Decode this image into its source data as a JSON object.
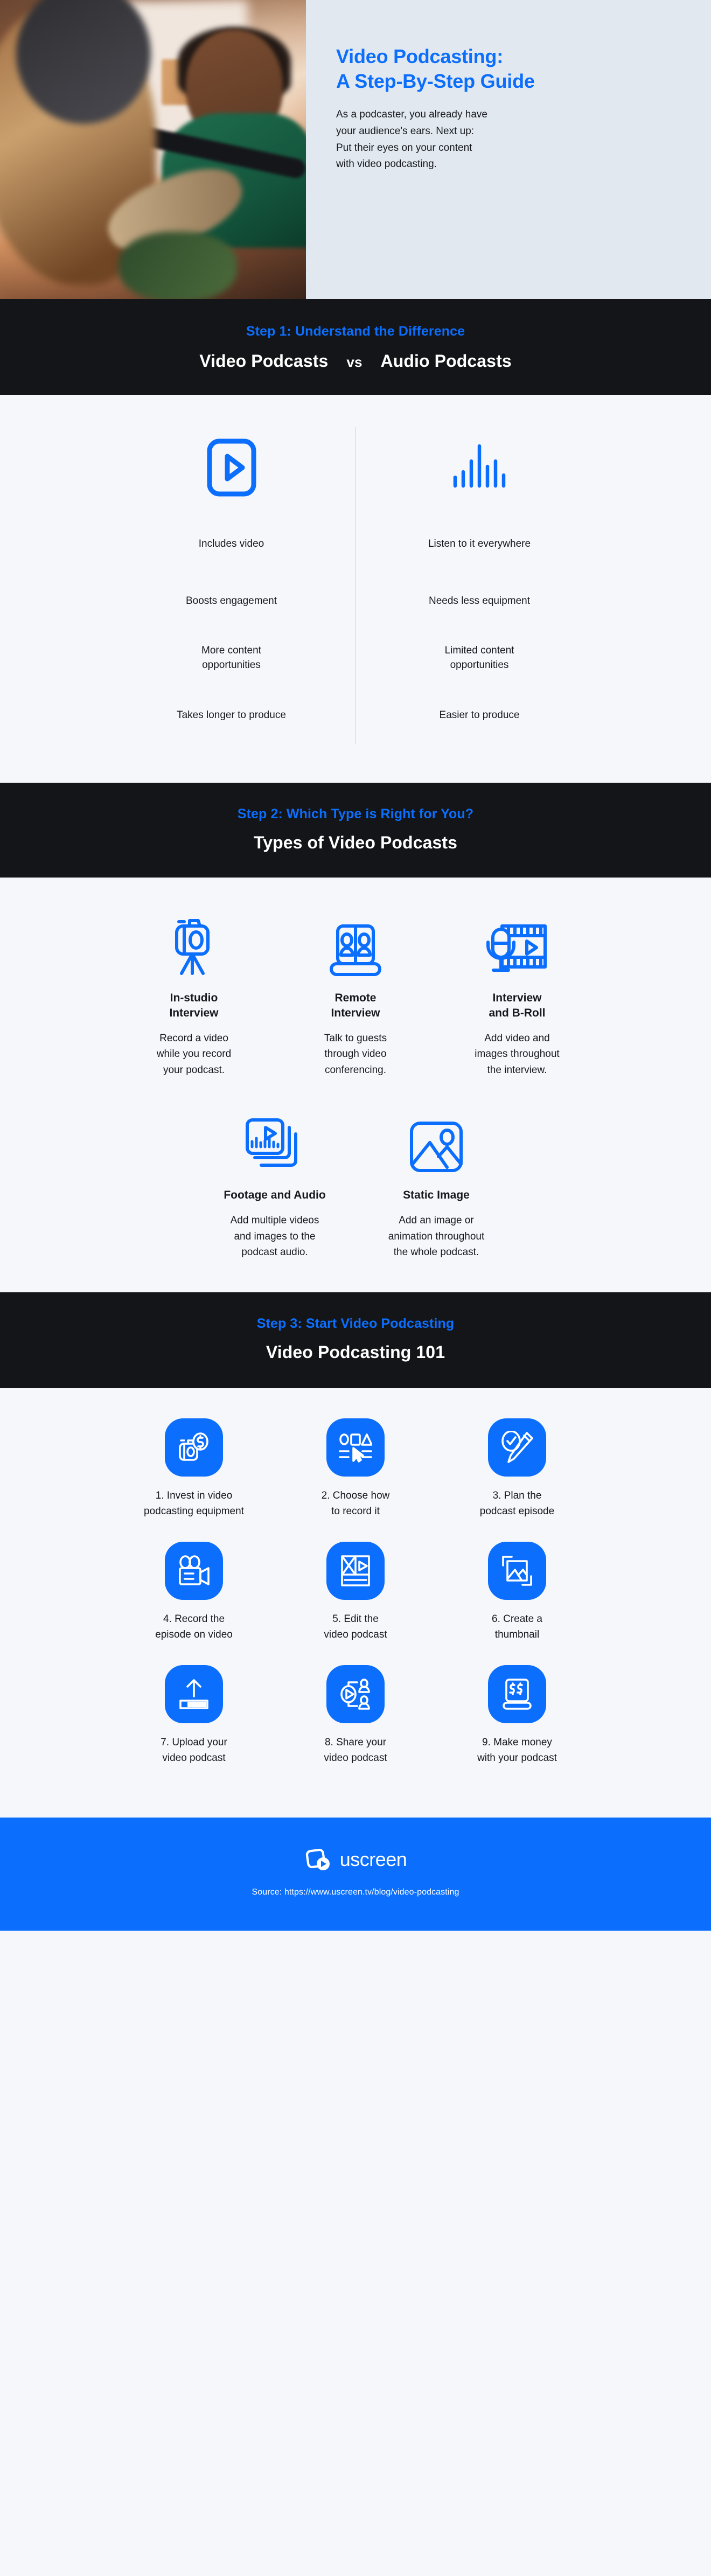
{
  "colors": {
    "brand_blue": "#0B6EFD",
    "band_black": "#141518",
    "page_bg": "#F5F7FB",
    "header_panel": "#E2E8F0"
  },
  "header": {
    "title": "Video Podcasting:\nA Step-By-Step Guide",
    "body": "As a podcaster, you already have\nyour audience's ears. Next up:\nPut their eyes on your content\nwith video podcasting.",
    "photo_alt": "podcast-studio-photo"
  },
  "step1": {
    "eyebrow": "Step 1: Understand the Difference",
    "left_heading": "Video Podcasts",
    "vs": "vs",
    "right_heading": "Audio Podcasts",
    "left": {
      "icon": "play-video-icon",
      "items": [
        "Includes video",
        "Boosts engagement",
        "More content\nopportunities",
        "Takes longer to produce"
      ]
    },
    "right": {
      "icon": "audio-waveform-icon",
      "items": [
        "Listen to it everywhere",
        "Needs less equipment",
        "Limited content\nopportunities",
        "Easier to produce"
      ]
    }
  },
  "step2": {
    "eyebrow": "Step 2: Which Type is Right for You?",
    "headline": "Types of Video Podcasts",
    "types": [
      {
        "icon": "camera-tripod-icon",
        "title": "In-studio\nInterview",
        "desc": "Record a video\nwhile you record\nyour podcast."
      },
      {
        "icon": "video-conference-laptop-icon",
        "title": "Remote\nInterview",
        "desc": "Talk to guests\nthrough video\nconferencing."
      },
      {
        "icon": "microphone-filmstrip-icon",
        "title": "Interview\nand B-Roll",
        "desc": "Add video and\nimages throughout\nthe interview."
      },
      {
        "icon": "stacked-media-cards-icon",
        "title": "Footage and Audio",
        "desc": "Add multiple videos\nand images to the\npodcast audio."
      },
      {
        "icon": "static-image-icon",
        "title": "Static Image",
        "desc": "Add an image or\nanimation throughout\nthe whole podcast."
      }
    ]
  },
  "step3": {
    "eyebrow": "Step 3: Start Video Podcasting",
    "headline": "Video Podcasting 101",
    "steps": [
      {
        "icon": "camera-dollar-icon",
        "label": "1. Invest in video\npodcasting equipment"
      },
      {
        "icon": "shapes-cursor-icon",
        "label": "2. Choose how\nto record it"
      },
      {
        "icon": "check-pen-icon",
        "label": "3. Plan the\npodcast episode"
      },
      {
        "icon": "film-camera-icon",
        "label": "4. Record the\nepisode on video"
      },
      {
        "icon": "video-editor-icon",
        "label": "5. Edit the\nvideo podcast"
      },
      {
        "icon": "thumbnail-crop-icon",
        "label": "6. Create a\nthumbnail"
      },
      {
        "icon": "upload-arrow-icon",
        "label": "7. Upload your\nvideo podcast"
      },
      {
        "icon": "share-play-icon",
        "label": "8. Share your\nvideo podcast"
      },
      {
        "icon": "money-screen-icon",
        "label": "9. Make money\nwith your podcast"
      }
    ]
  },
  "footer": {
    "logo_icon": "uscreen-play-logo",
    "logo_text": "uscreen",
    "source": "Source: https://www.uscreen.tv/blog/video-podcasting"
  }
}
